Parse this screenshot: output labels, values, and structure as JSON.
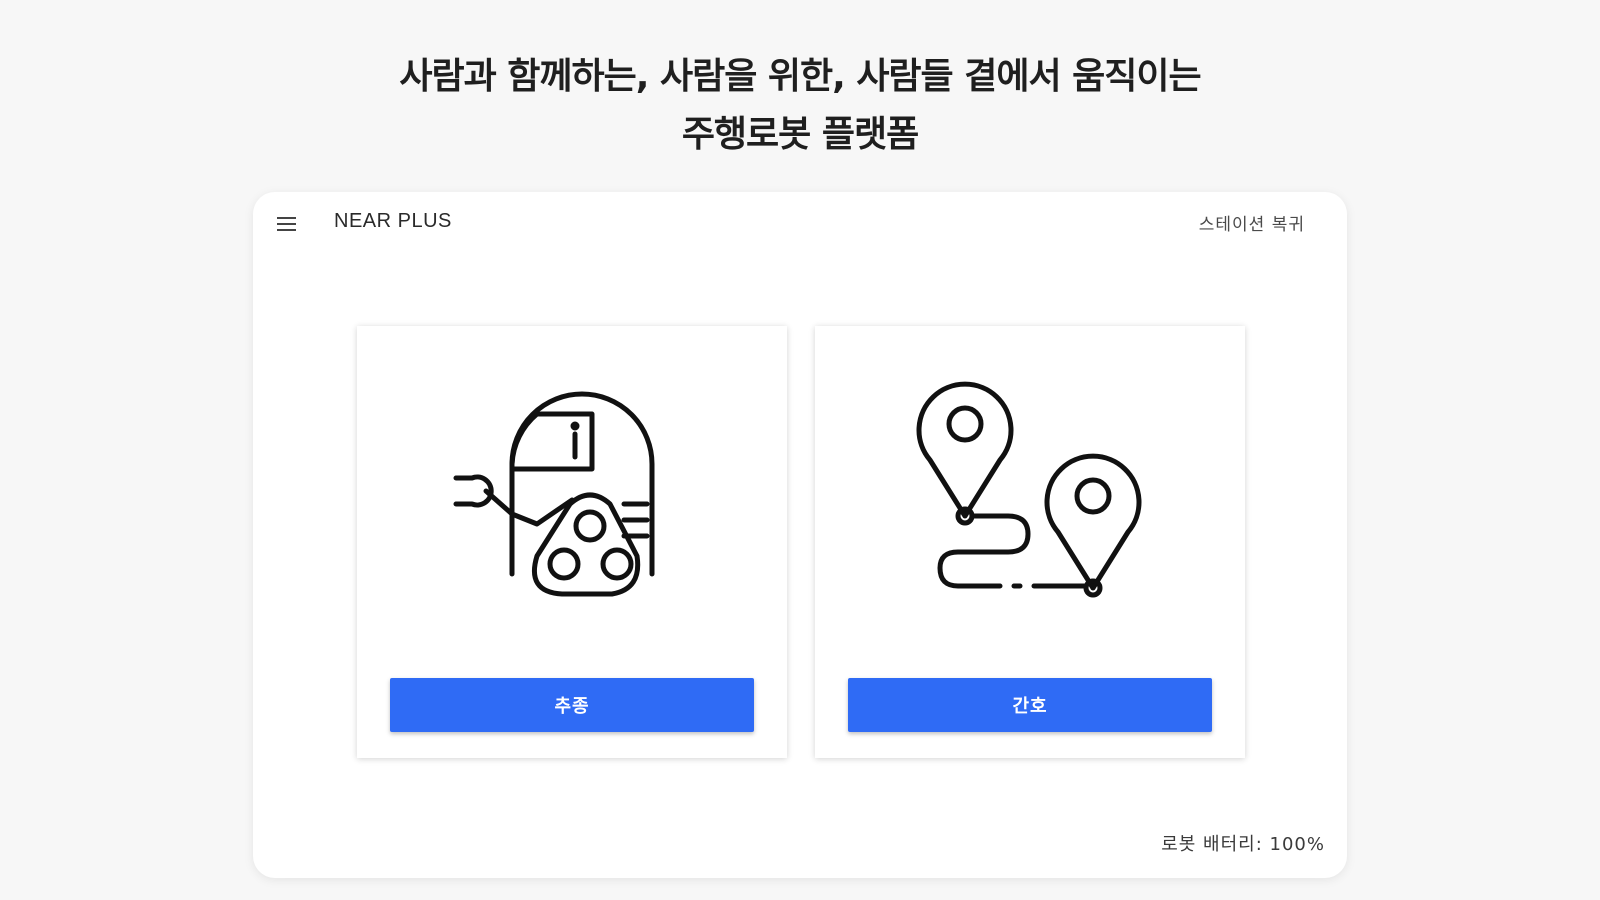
{
  "headline": {
    "line1": "사람과 함께하는, 사람을 위한, 사람들 곁에서 움직이는",
    "line2": "주행로봇 플랫폼"
  },
  "app": {
    "title": "NEAR PLUS",
    "station_return": "스테이션 복귀",
    "menu_icon": "hamburger-menu-icon"
  },
  "cards": [
    {
      "icon": "robot-icon",
      "button_label": "추종"
    },
    {
      "icon": "route-pins-icon",
      "button_label": "간호"
    }
  ],
  "status": {
    "battery": "로봇 배터리: 100%"
  },
  "colors": {
    "accent": "#2f6bf5",
    "page_bg": "#f7f7f7",
    "card_bg": "#ffffff"
  }
}
